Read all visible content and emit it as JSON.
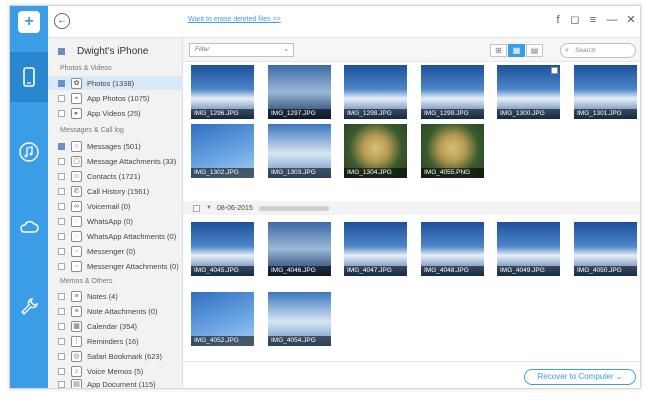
{
  "header": {
    "back_icon": "back-arrow-icon",
    "erase_link": "Want to erase deleted files >>",
    "controls": [
      "f",
      "◻",
      "≡",
      "—",
      "✕"
    ]
  },
  "rail": {
    "logo": "+",
    "items": [
      {
        "icon": "phone-icon",
        "active": true
      },
      {
        "icon": "music-icon",
        "active": false
      },
      {
        "icon": "cloud-icon",
        "active": false
      },
      {
        "icon": "wrench-icon",
        "active": false
      }
    ]
  },
  "sidebar": {
    "device": "Dwight's iPhone",
    "sections": [
      {
        "title": "Photos & Videos",
        "items": [
          "Photos (1338)",
          "App Photos (1075)",
          "App Videos (25)"
        ]
      },
      {
        "title": "Messages & Call log",
        "items": [
          "Messages (501)",
          "Message Attachments (33)",
          "Contacts (1721)",
          "Call History (1561)",
          "Voicemail (0)",
          "WhatsApp (0)",
          "WhatsApp Attachments (0)",
          "Messenger (0)",
          "Messenger Attachments (0)"
        ]
      },
      {
        "title": "Memos & Others",
        "items": [
          "Notes (4)",
          "Note Attachments (0)",
          "Calendar (354)",
          "Reminders (16)",
          "Safari Bookmark (623)",
          "Voice Memos (5)",
          "App Document (115)"
        ]
      }
    ]
  },
  "toolbar": {
    "filter_placeholder": "Filter",
    "search_placeholder": "Search"
  },
  "photos_group1": [
    "IMG_1296.JPG",
    "IMG_1297.JPG",
    "IMG_1298.JPG",
    "IMG_1299.JPG",
    "IMG_1300.JPG",
    "IMG_1301.JPG",
    "IMG_1302.JPG",
    "IMG_1303.JPG",
    "IMG_1304.JPG",
    "IMG_4055.PNG"
  ],
  "date_group": "08-06-2015",
  "photos_group2": [
    "IMG_4045.JPG",
    "IMG_4046.JPG",
    "IMG_4047.JPG",
    "IMG_4048.JPG",
    "IMG_4049.JPG",
    "IMG_4050.JPG",
    "IMG_4052.JPG",
    "IMG_4054.JPG"
  ],
  "footer": {
    "recover_label": "Recover to Computer"
  }
}
